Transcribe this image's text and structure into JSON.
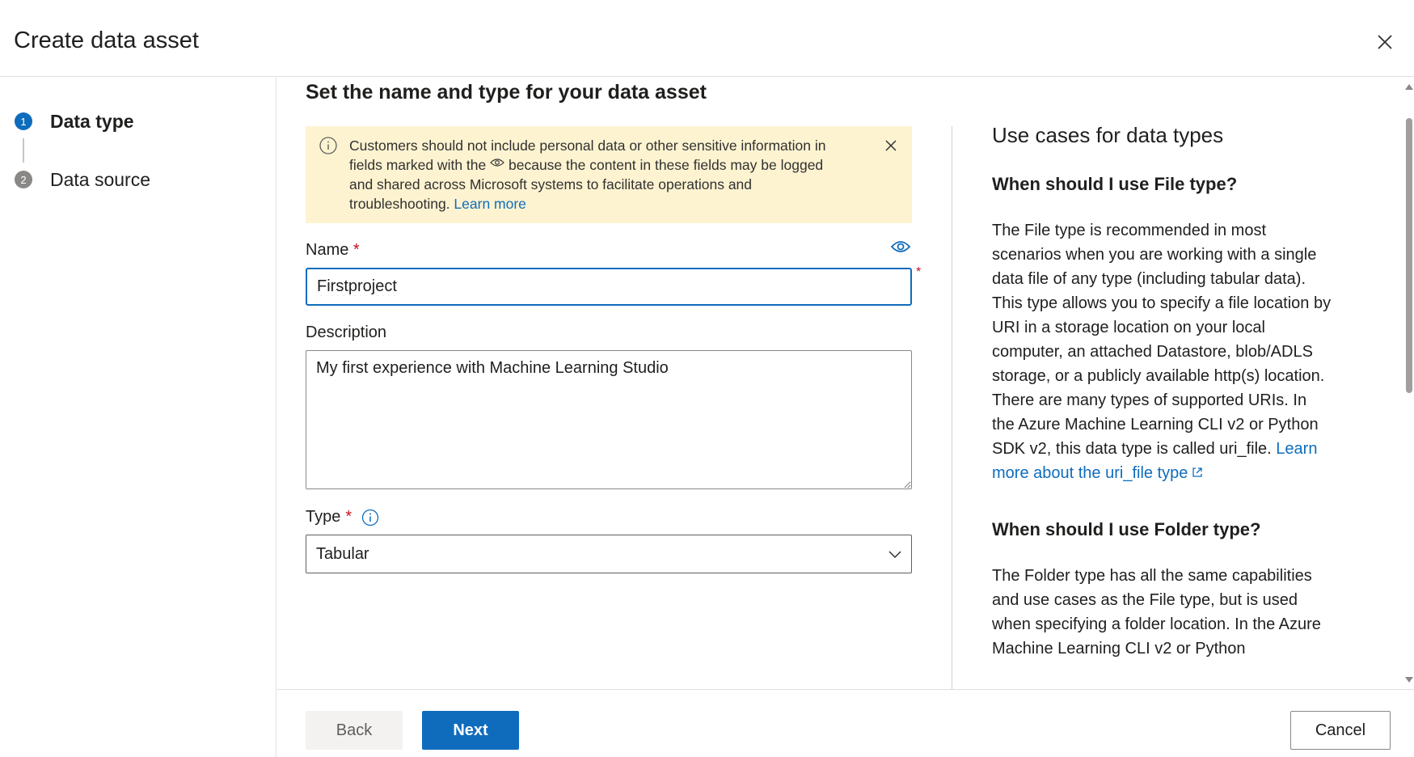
{
  "dialog": {
    "title": "Create data asset",
    "close_icon": "close-icon"
  },
  "steps": [
    {
      "number": "1",
      "label": "Data type",
      "state": "active"
    },
    {
      "number": "2",
      "label": "Data source",
      "state": "inactive"
    }
  ],
  "form": {
    "heading": "Set the name and type for your data asset",
    "banner": {
      "text_before_icon": "Customers should not include personal data or other sensitive information in fields marked with the",
      "text_after_icon": "because the content in these fields may be logged and shared across Microsoft systems to facilitate operations and troubleshooting.",
      "link": "Learn more"
    },
    "name": {
      "label": "Name",
      "required_mark": "*",
      "value": "Firstproject"
    },
    "description": {
      "label": "Description",
      "value": "My first experience with Machine Learning Studio"
    },
    "type": {
      "label": "Type",
      "required_mark": "*",
      "selected": "Tabular"
    }
  },
  "help": {
    "title": "Use cases for data types",
    "sections": [
      {
        "heading": "When should I use File type?",
        "body": "The File type is recommended in most scenarios when you are working with a single data file of any type (including tabular data). This type allows you to specify a file location by URI in a storage location on your local computer, an attached Datastore, blob/ADLS storage, or a publicly available http(s) location. There are many types of supported URIs. In the Azure Machine Learning CLI v2 or Python SDK v2, this data type is called uri_file.",
        "link": "Learn more about the uri_file type"
      },
      {
        "heading": "When should I use Folder type?",
        "body": "The Folder type has all the same capabilities and use cases as the File type, but is used when specifying a folder location. In the Azure Machine Learning CLI v2 or Python"
      }
    ]
  },
  "footer": {
    "back": "Back",
    "next": "Next",
    "cancel": "Cancel"
  },
  "colors": {
    "accent": "#0f6cbd",
    "banner_bg": "#fdf3d1",
    "required": "#c50f1f"
  }
}
